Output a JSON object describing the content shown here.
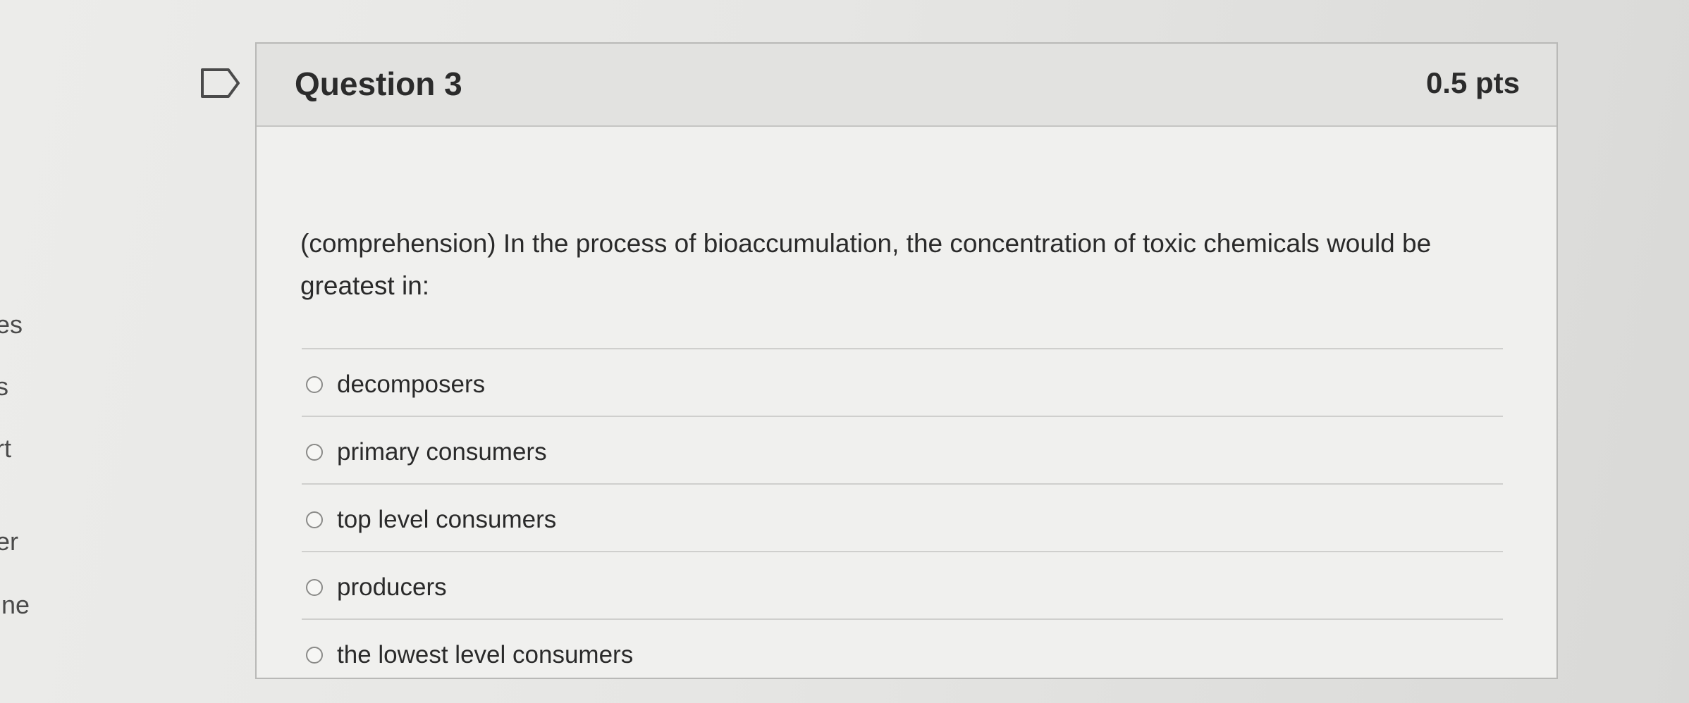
{
  "left_nav": {
    "items": [
      "es",
      "s",
      "rt",
      "er",
      "ine"
    ]
  },
  "question": {
    "title": "Question 3",
    "points": "0.5 pts",
    "text": "(comprehension) In the process of bioaccumulation, the concentration of toxic chemicals would be greatest in:",
    "answers": [
      {
        "label": "decomposers",
        "selected": false
      },
      {
        "label": "primary consumers",
        "selected": false
      },
      {
        "label": "top level consumers",
        "selected": false
      },
      {
        "label": "producers",
        "selected": false
      },
      {
        "label": "the lowest level consumers",
        "selected": false
      }
    ]
  },
  "icons": {
    "flag": "flag-icon",
    "radio": "radio-button-icon"
  },
  "colors": {
    "header_bg": "#e2e2e0",
    "body_bg": "#f0f0ee",
    "border": "#b9b9b7"
  }
}
